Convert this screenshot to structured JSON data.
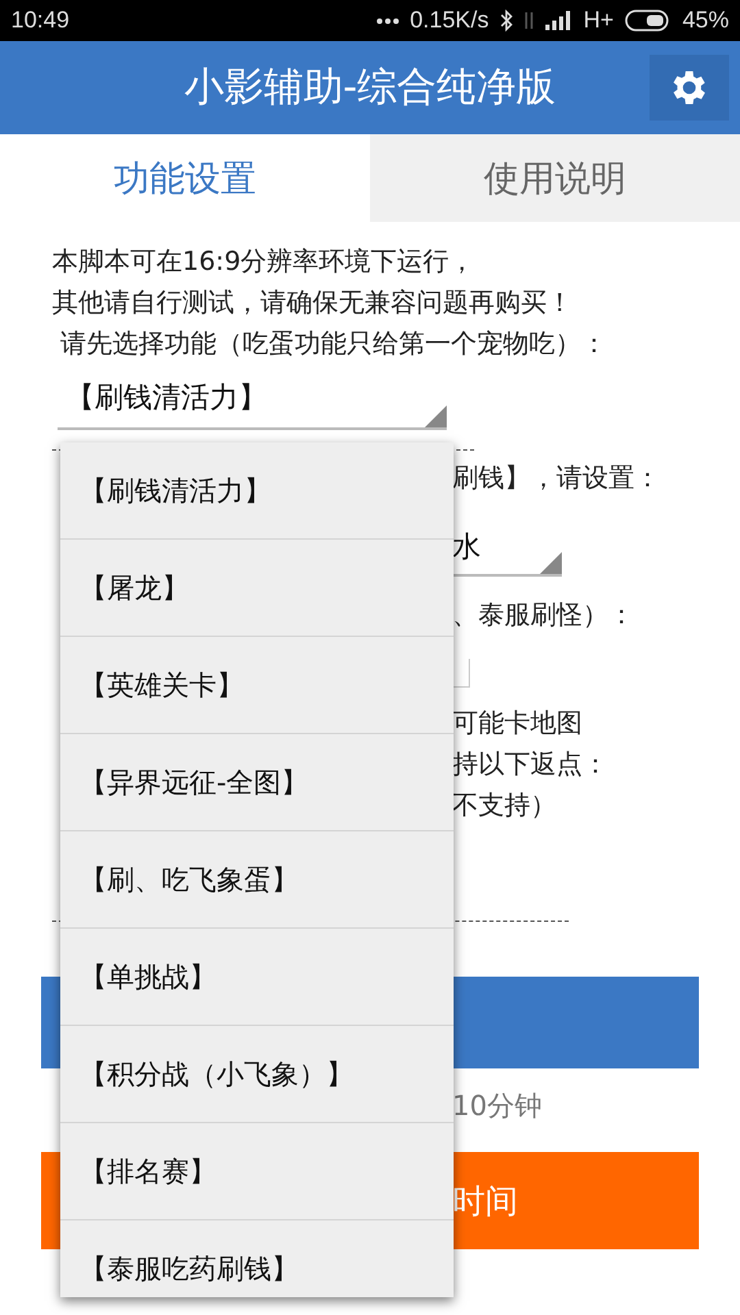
{
  "status_bar": {
    "time": "10:49",
    "speed": "0.15K/s",
    "network": "H+",
    "battery": "45%"
  },
  "header": {
    "title": "小影辅助-综合纯净版"
  },
  "tabs": [
    {
      "label": "功能设置",
      "selected": true
    },
    {
      "label": "使用说明",
      "selected": false
    }
  ],
  "intro": [
    "本脚本可在16:9分辨率环境下运行，",
    "其他请自行测试，请确保无兼容问题再购买！",
    " 请先选择功能（吃蛋功能只给第一个宠物吃）："
  ],
  "function_select": {
    "value": "【刷钱清活力】"
  },
  "partial_lines": [
    {
      "kind": "text",
      "text": "刷钱】，请设置："
    },
    {
      "kind": "select",
      "text": "水"
    },
    {
      "kind": "text",
      "text": "、泰服刷怪）："
    },
    {
      "kind": "field"
    },
    {
      "kind": "text",
      "text": "可能卡地图"
    },
    {
      "kind": "text",
      "text": "持以下返点："
    },
    {
      "kind": "text",
      "text": "不支持）"
    }
  ],
  "note": "10分钟",
  "orange_button": {
    "label": "时间"
  },
  "dropdown_menu": {
    "items": [
      "【刷钱清活力】",
      "【屠龙】",
      "【英雄关卡】",
      "【异界远征-全图】",
      "【刷、吃飞象蛋】",
      "【单挑战】",
      "【积分战（小飞象）】",
      "【排名赛】",
      "【泰服吃药刷钱】"
    ]
  }
}
